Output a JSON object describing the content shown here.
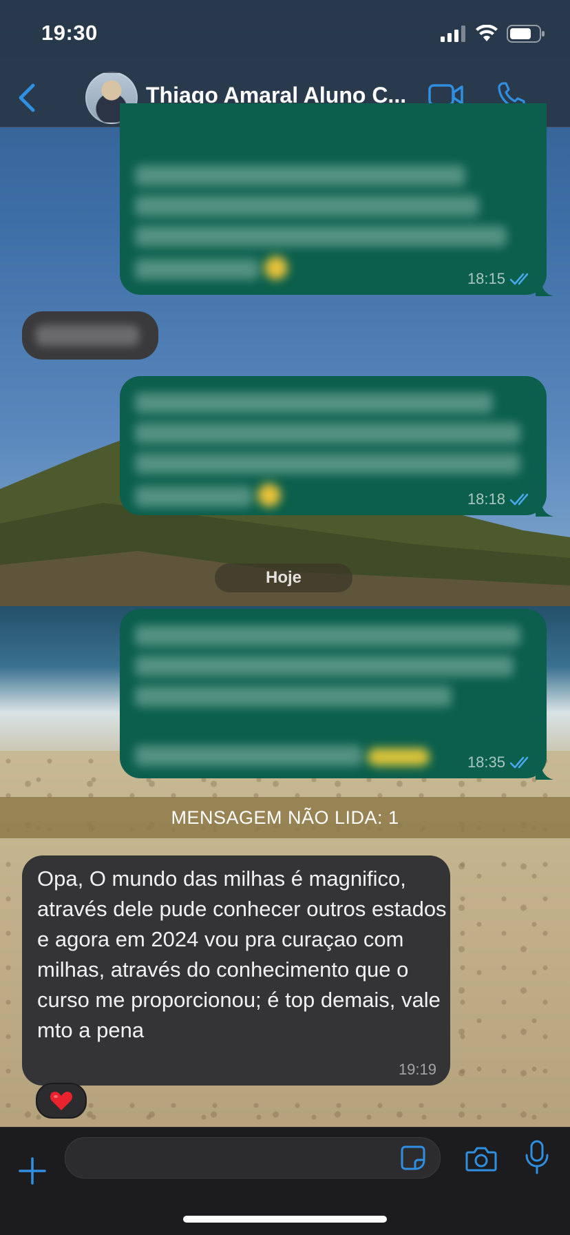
{
  "status_bar": {
    "time": "19:30"
  },
  "header": {
    "contact_name": "Thiago Amaral Aluno C..."
  },
  "messages": [
    {
      "direction": "outgoing",
      "blurred": true,
      "time": "18:15",
      "status": "read"
    },
    {
      "direction": "incoming",
      "blurred": true
    },
    {
      "direction": "outgoing",
      "blurred": true,
      "time": "18:18",
      "status": "read"
    },
    {
      "direction": "outgoing",
      "blurred": true,
      "time": "18:35",
      "status": "read"
    }
  ],
  "date_divider": "Hoje",
  "unread_banner": "MENSAGEM NÃO LIDA: 1",
  "incoming_message": {
    "text": "Opa, O mundo das milhas é magnifico, através dele pude conhecer outros estados e agora em 2024 vou pra curaçao com milhas, através do conhecimento que o curso me proporcionou; é top demais, vale mto a pena",
    "time": "19:19",
    "reaction": "❤️"
  },
  "composer": {
    "placeholder": ""
  },
  "colors": {
    "accent": "#2f8fe0",
    "outgoing_bubble": "#0b5f4c",
    "incoming_bubble": "#343436"
  },
  "icons": [
    "back-icon",
    "video-call-icon",
    "phone-icon",
    "plus-icon",
    "sticker-icon",
    "camera-icon",
    "mic-icon",
    "read-receipt-icon"
  ]
}
